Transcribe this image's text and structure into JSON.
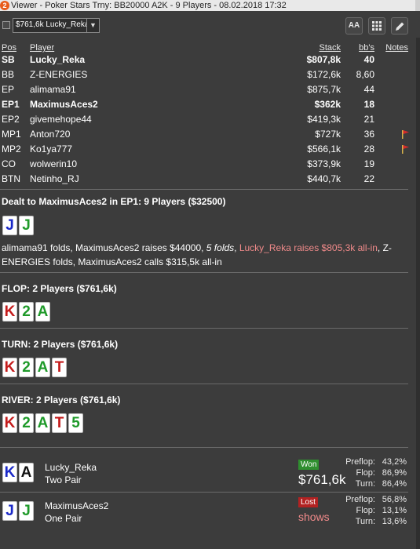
{
  "window": {
    "title": "Viewer - Poker Stars Trny: BB20000 A2K - 9 Players - 08.02.2018 17:32",
    "app_icon": "2"
  },
  "toolbar": {
    "combo_value": "$761,6k Lucky_Reka",
    "icons": [
      "font-size-icon",
      "grid-icon",
      "edit-icon"
    ],
    "font_btn_label": "AA"
  },
  "players": {
    "headers": {
      "pos": "Pos",
      "player": "Player",
      "stack": "Stack",
      "bb": "bb's",
      "notes": "Notes"
    },
    "rows": [
      {
        "pos": "SB",
        "name": "Lucky_Reka",
        "stack": "$807,8k",
        "bb": "40",
        "bold": true,
        "flag": false
      },
      {
        "pos": "BB",
        "name": "Z-ENERGIES",
        "stack": "$172,6k",
        "bb": "8,60",
        "bold": false,
        "flag": false
      },
      {
        "pos": "EP",
        "name": "alimama91",
        "stack": "$875,7k",
        "bb": "44",
        "bold": false,
        "flag": false
      },
      {
        "pos": "EP1",
        "name": "MaximusAces2",
        "stack": "$362k",
        "bb": "18",
        "bold": true,
        "flag": false
      },
      {
        "pos": "EP2",
        "name": "givemehope44",
        "stack": "$419,3k",
        "bb": "21",
        "bold": false,
        "flag": false
      },
      {
        "pos": "MP1",
        "name": "Anton720",
        "stack": "$727k",
        "bb": "36",
        "bold": false,
        "flag": true
      },
      {
        "pos": "MP2",
        "name": "Ko1ya777",
        "stack": "$566,1k",
        "bb": "28",
        "bold": false,
        "flag": true
      },
      {
        "pos": "CO",
        "name": "wolwerin10",
        "stack": "$373,9k",
        "bb": "19",
        "bold": false,
        "flag": false
      },
      {
        "pos": "BTN",
        "name": "Netinho_RJ",
        "stack": "$440,7k",
        "bb": "22",
        "bold": false,
        "flag": false
      }
    ]
  },
  "preflop": {
    "title": "Dealt to MaximusAces2 in EP1: 9 Players ($32500)",
    "cards": [
      {
        "rank": "J",
        "suit": "blue"
      },
      {
        "rank": "J",
        "suit": "green"
      }
    ],
    "action_part1": "alimama91 folds, MaximusAces2 raises $44000, ",
    "action_folds": "5 folds",
    "action_comma": ", ",
    "action_allin": "Lucky_Reka raises $805,3k all-in",
    "action_part2": ", Z-ENERGIES folds, MaximusAces2 calls $315,5k all-in"
  },
  "flop": {
    "title": "FLOP: 2 Players ($761,6k)",
    "cards": [
      {
        "rank": "K",
        "suit": "red"
      },
      {
        "rank": "2",
        "suit": "green"
      },
      {
        "rank": "A",
        "suit": "green"
      }
    ]
  },
  "turn": {
    "title": "TURN: 2 Players ($761,6k)",
    "cards": [
      {
        "rank": "K",
        "suit": "red"
      },
      {
        "rank": "2",
        "suit": "green"
      },
      {
        "rank": "A",
        "suit": "green"
      },
      {
        "rank": "T",
        "suit": "red"
      }
    ]
  },
  "river": {
    "title": "RIVER: 2 Players ($761,6k)",
    "cards": [
      {
        "rank": "K",
        "suit": "red"
      },
      {
        "rank": "2",
        "suit": "green"
      },
      {
        "rank": "A",
        "suit": "green"
      },
      {
        "rank": "T",
        "suit": "red"
      },
      {
        "rank": "5",
        "suit": "green"
      }
    ]
  },
  "results": [
    {
      "name": "Lucky_Reka",
      "hand": "Two Pair",
      "cards": [
        {
          "rank": "K",
          "suit": "blue"
        },
        {
          "rank": "A",
          "suit": "black"
        }
      ],
      "badge": "Won",
      "amount": "$761,6k",
      "equity": [
        {
          "label": "Preflop:",
          "value": "43,2%"
        },
        {
          "label": "Flop:",
          "value": "86,9%"
        },
        {
          "label": "Turn:",
          "value": "86,4%"
        }
      ]
    },
    {
      "name": "MaximusAces2",
      "hand": "One Pair",
      "cards": [
        {
          "rank": "J",
          "suit": "blue"
        },
        {
          "rank": "J",
          "suit": "green"
        }
      ],
      "badge": "Lost",
      "amount": "shows",
      "equity": [
        {
          "label": "Preflop:",
          "value": "56,8%"
        },
        {
          "label": "Flop:",
          "value": "13,1%"
        },
        {
          "label": "Turn:",
          "value": "13,6%"
        }
      ]
    }
  ]
}
